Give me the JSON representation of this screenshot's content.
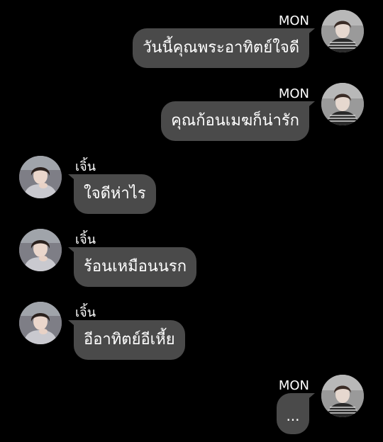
{
  "chat": {
    "messages": [
      {
        "sender": "MON",
        "text": "วันนี้คุณพระอาทิตย์ใจดี"
      },
      {
        "sender": "MON",
        "text": "คุณก้อนเมฆก็น่ารัก"
      },
      {
        "sender": "เจิ้น",
        "text": "ใจดีห่าไร"
      },
      {
        "sender": "เจิ้น",
        "text": "ร้อนเหมือนนรก"
      },
      {
        "sender": "เจิ้น",
        "text": "อีอาทิตย์อีเหี้ย"
      },
      {
        "sender": "MON",
        "text": "..."
      }
    ]
  },
  "colors": {
    "background": "#000000",
    "bubble": "#4a4a4a",
    "text": "#ffffff"
  },
  "icons": {
    "mon_avatar": "avatar-mon-icon",
    "jin_avatar": "avatar-jin-icon"
  }
}
